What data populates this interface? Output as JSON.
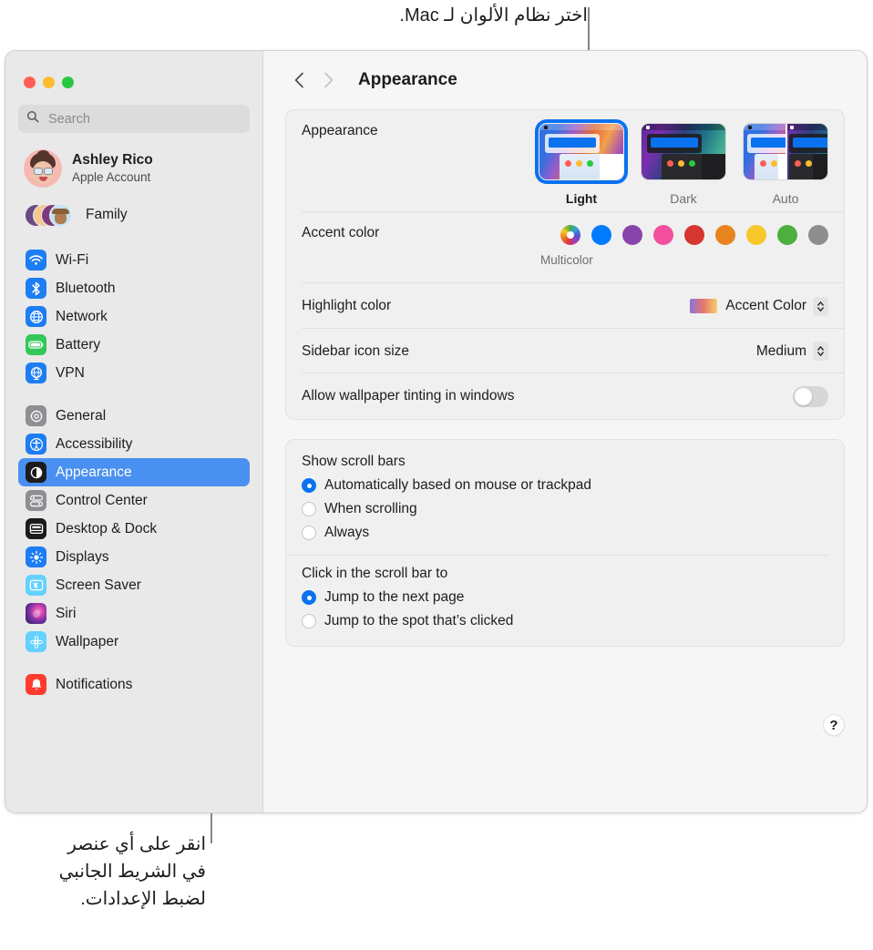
{
  "callouts": {
    "top": "اختر نظام الألوان لـ Mac.",
    "bottom": "انقر على أي عنصر\nفي الشريط الجانبي\nلضبط الإعدادات."
  },
  "window": {
    "title": "Appearance",
    "back_icon": "chevron-left-icon",
    "forward_icon": "chevron-right-icon"
  },
  "sidebar": {
    "search": {
      "placeholder": "Search",
      "value": "",
      "icon": "search-icon"
    },
    "account": {
      "name": "Ashley Rico",
      "subtitle": "Apple Account",
      "avatar": "memoji-avatar"
    },
    "family": {
      "label": "Family",
      "icon": "family-avatars"
    },
    "groups": [
      {
        "items": [
          {
            "label": "Wi-Fi",
            "icon": "wifi-icon",
            "color": "#1d7df4"
          },
          {
            "label": "Bluetooth",
            "icon": "bluetooth-icon",
            "color": "#1d7df4"
          },
          {
            "label": "Network",
            "icon": "globe-icon",
            "color": "#1d7df4"
          },
          {
            "label": "Battery",
            "icon": "battery-icon",
            "color": "#34c759"
          },
          {
            "label": "VPN",
            "icon": "vpn-globe-icon",
            "color": "#1d7df4"
          }
        ]
      },
      {
        "items": [
          {
            "label": "General",
            "icon": "gear-icon",
            "color": "#8e8e93"
          },
          {
            "label": "Accessibility",
            "icon": "accessibility-icon",
            "color": "#1d7df4"
          },
          {
            "label": "Appearance",
            "icon": "appearance-contrast-icon",
            "color": "#1c1c1e",
            "selected": true
          },
          {
            "label": "Control Center",
            "icon": "control-center-icon",
            "color": "#8e8e93"
          },
          {
            "label": "Desktop & Dock",
            "icon": "desktop-dock-icon",
            "color": "#1c1c1e"
          },
          {
            "label": "Displays",
            "icon": "brightness-icon",
            "color": "#1d7df4"
          },
          {
            "label": "Screen Saver",
            "icon": "screen-saver-icon",
            "color": "#64d2ff"
          },
          {
            "label": "Siri",
            "icon": "siri-icon",
            "color": "#2a1f3d"
          },
          {
            "label": "Wallpaper",
            "icon": "wallpaper-flower-icon",
            "color": "#64d2ff"
          }
        ]
      },
      {
        "items": [
          {
            "label": "Notifications",
            "icon": "bell-icon",
            "color": "#ff3b30"
          }
        ]
      }
    ]
  },
  "appearance": {
    "label": "Appearance",
    "options": [
      {
        "label": "Light",
        "selected": true
      },
      {
        "label": "Dark",
        "selected": false
      },
      {
        "label": "Auto",
        "selected": false
      }
    ]
  },
  "accent": {
    "label": "Accent color",
    "caption": "Multicolor",
    "swatches": [
      {
        "name": "multicolor",
        "color": "multicolor",
        "selected": true
      },
      {
        "name": "blue",
        "color": "#007AFF",
        "selected": false
      },
      {
        "name": "purple",
        "color": "#8944AB",
        "selected": false
      },
      {
        "name": "pink",
        "color": "#F2509E",
        "selected": false
      },
      {
        "name": "red",
        "color": "#D5362F",
        "selected": false
      },
      {
        "name": "orange",
        "color": "#E8841D",
        "selected": false
      },
      {
        "name": "yellow",
        "color": "#F8C82B",
        "selected": false
      },
      {
        "name": "green",
        "color": "#4CAF3E",
        "selected": false
      },
      {
        "name": "graphite",
        "color": "#8E8E8E",
        "selected": false
      }
    ]
  },
  "highlight": {
    "label": "Highlight color",
    "value": "Accent Color"
  },
  "sidebar_icon_size": {
    "label": "Sidebar icon size",
    "value": "Medium"
  },
  "wallpaper_tinting": {
    "label": "Allow wallpaper tinting in windows",
    "enabled": false
  },
  "scroll_bars": {
    "title": "Show scroll bars",
    "options": [
      {
        "label": "Automatically based on mouse or trackpad",
        "selected": true
      },
      {
        "label": "When scrolling",
        "selected": false
      },
      {
        "label": "Always",
        "selected": false
      }
    ]
  },
  "click_scroll_bar": {
    "title": "Click in the scroll bar to",
    "options": [
      {
        "label": "Jump to the next page",
        "selected": true
      },
      {
        "label": "Jump to the spot that’s clicked",
        "selected": false
      }
    ]
  },
  "help": {
    "label": "?",
    "icon": "help-question-icon"
  }
}
